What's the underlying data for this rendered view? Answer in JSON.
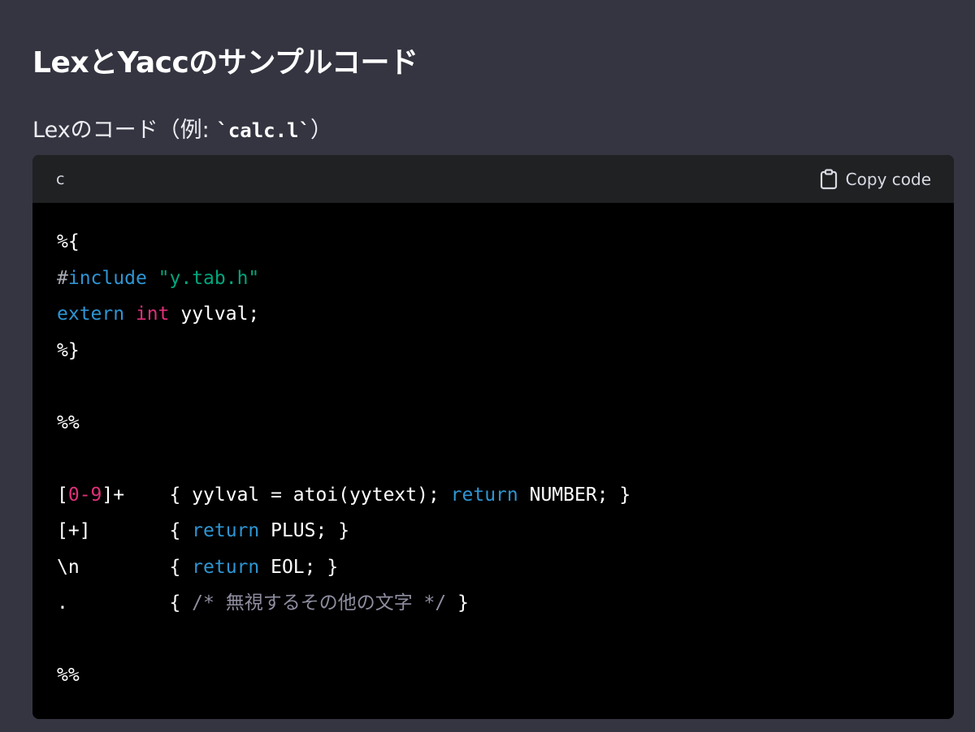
{
  "heading": "LexとYaccのサンプルコード",
  "subheading": {
    "prefix": "Lexのコード（例: ",
    "code": "`calc.l`",
    "suffix": "）"
  },
  "code_block": {
    "language": "c",
    "copy_label": "Copy code",
    "copy_icon": "clipboard-icon",
    "lines": [
      [
        {
          "t": "%{",
          "c": ""
        }
      ],
      [
        {
          "t": "#",
          "c": "tok-hash"
        },
        {
          "t": "include",
          "c": "tok-meta"
        },
        {
          "t": " ",
          "c": ""
        },
        {
          "t": "\"y.tab.h\"",
          "c": "tok-str"
        }
      ],
      [
        {
          "t": "extern",
          "c": "tok-kw"
        },
        {
          "t": " ",
          "c": ""
        },
        {
          "t": "int",
          "c": "tok-type2"
        },
        {
          "t": " yylval;",
          "c": ""
        }
      ],
      [
        {
          "t": "%}",
          "c": ""
        }
      ],
      [],
      [
        {
          "t": "%%",
          "c": ""
        }
      ],
      [],
      [
        {
          "t": "[",
          "c": ""
        },
        {
          "t": "0-9",
          "c": "tok-num"
        },
        {
          "t": "]+    { yylval = atoi(yytext); ",
          "c": ""
        },
        {
          "t": "return",
          "c": "tok-kw"
        },
        {
          "t": " NUMBER; }",
          "c": ""
        }
      ],
      [
        {
          "t": "[+]       { ",
          "c": ""
        },
        {
          "t": "return",
          "c": "tok-kw"
        },
        {
          "t": " PLUS; }",
          "c": ""
        }
      ],
      [
        {
          "t": "\\n        { ",
          "c": ""
        },
        {
          "t": "return",
          "c": "tok-kw"
        },
        {
          "t": " EOL; }",
          "c": ""
        }
      ],
      [
        {
          "t": ".         { ",
          "c": ""
        },
        {
          "t": "/* 無視するその他の文字 */",
          "c": "tok-comment"
        },
        {
          "t": " }",
          "c": ""
        }
      ],
      [],
      [
        {
          "t": "%%",
          "c": ""
        }
      ]
    ]
  }
}
